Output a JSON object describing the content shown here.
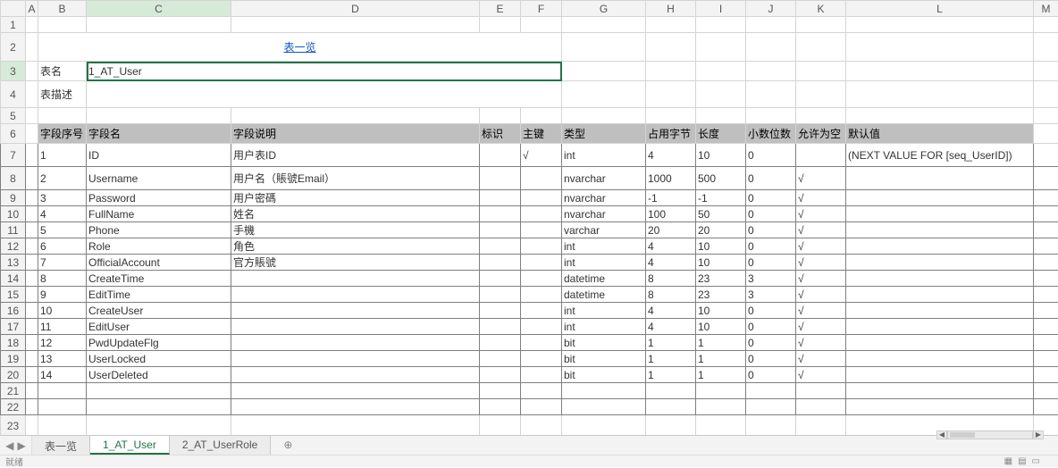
{
  "columns": [
    "A",
    "B",
    "C",
    "D",
    "E",
    "F",
    "G",
    "H",
    "I",
    "J",
    "K",
    "L",
    "M"
  ],
  "row_numbers": [
    1,
    2,
    3,
    4,
    5,
    6,
    7,
    8,
    9,
    10,
    11,
    12,
    13,
    14,
    15,
    16,
    17,
    18,
    19,
    20,
    21,
    22,
    23
  ],
  "title_link": "表一览",
  "meta": {
    "name_label": "表名",
    "name_value": "1_AT_User",
    "desc_label": "表描述",
    "desc_value": ""
  },
  "headers": {
    "seq": "字段序号",
    "field": "字段名",
    "desc": "字段说明",
    "ident": "标识",
    "pk": "主键",
    "type": "类型",
    "bytes": "占用字节",
    "len": "长度",
    "scale": "小数位数",
    "null": "允许为空",
    "default": "默认值"
  },
  "rows": [
    {
      "seq": "1",
      "field": "ID",
      "desc": "用户表ID",
      "ident": "",
      "pk": "√",
      "type": "int",
      "bytes": "4",
      "len": "10",
      "scale": "0",
      "null": "",
      "default": "(NEXT VALUE FOR [seq_UserID])"
    },
    {
      "seq": "2",
      "field": "Username",
      "desc": "用户名（賬號Email）",
      "ident": "",
      "pk": "",
      "type": "nvarchar",
      "bytes": "1000",
      "len": "500",
      "scale": "0",
      "null": "√",
      "default": ""
    },
    {
      "seq": "3",
      "field": "Password",
      "desc": "用户密碼",
      "ident": "",
      "pk": "",
      "type": "nvarchar",
      "bytes": "-1",
      "len": "-1",
      "scale": "0",
      "null": "√",
      "default": ""
    },
    {
      "seq": "4",
      "field": "FullName",
      "desc": "姓名",
      "ident": "",
      "pk": "",
      "type": "nvarchar",
      "bytes": "100",
      "len": "50",
      "scale": "0",
      "null": "√",
      "default": ""
    },
    {
      "seq": "5",
      "field": "Phone",
      "desc": "手機",
      "ident": "",
      "pk": "",
      "type": "varchar",
      "bytes": "20",
      "len": "20",
      "scale": "0",
      "null": "√",
      "default": ""
    },
    {
      "seq": "6",
      "field": "Role",
      "desc": "角色",
      "ident": "",
      "pk": "",
      "type": "int",
      "bytes": "4",
      "len": "10",
      "scale": "0",
      "null": "√",
      "default": ""
    },
    {
      "seq": "7",
      "field": "OfficialAccount",
      "desc": "官方賬號",
      "ident": "",
      "pk": "",
      "type": "int",
      "bytes": "4",
      "len": "10",
      "scale": "0",
      "null": "√",
      "default": ""
    },
    {
      "seq": "8",
      "field": "CreateTime",
      "desc": "",
      "ident": "",
      "pk": "",
      "type": "datetime",
      "bytes": "8",
      "len": "23",
      "scale": "3",
      "null": "√",
      "default": ""
    },
    {
      "seq": "9",
      "field": "EditTime",
      "desc": "",
      "ident": "",
      "pk": "",
      "type": "datetime",
      "bytes": "8",
      "len": "23",
      "scale": "3",
      "null": "√",
      "default": ""
    },
    {
      "seq": "10",
      "field": "CreateUser",
      "desc": "",
      "ident": "",
      "pk": "",
      "type": "int",
      "bytes": "4",
      "len": "10",
      "scale": "0",
      "null": "√",
      "default": ""
    },
    {
      "seq": "11",
      "field": "EditUser",
      "desc": "",
      "ident": "",
      "pk": "",
      "type": "int",
      "bytes": "4",
      "len": "10",
      "scale": "0",
      "null": "√",
      "default": ""
    },
    {
      "seq": "12",
      "field": "PwdUpdateFlg",
      "desc": "",
      "ident": "",
      "pk": "",
      "type": "bit",
      "bytes": "1",
      "len": "1",
      "scale": "0",
      "null": "√",
      "default": ""
    },
    {
      "seq": "13",
      "field": "UserLocked",
      "desc": "",
      "ident": "",
      "pk": "",
      "type": "bit",
      "bytes": "1",
      "len": "1",
      "scale": "0",
      "null": "√",
      "default": ""
    },
    {
      "seq": "14",
      "field": "UserDeleted",
      "desc": "",
      "ident": "",
      "pk": "",
      "type": "bit",
      "bytes": "1",
      "len": "1",
      "scale": "0",
      "null": "√",
      "default": ""
    }
  ],
  "tabs": {
    "items": [
      "表一览",
      "1_AT_User",
      "2_AT_UserRole"
    ],
    "active_index": 1,
    "add_glyph": "⊕"
  },
  "status": {
    "ready": "就绪"
  },
  "selection": {
    "row": 3,
    "col": "C"
  }
}
